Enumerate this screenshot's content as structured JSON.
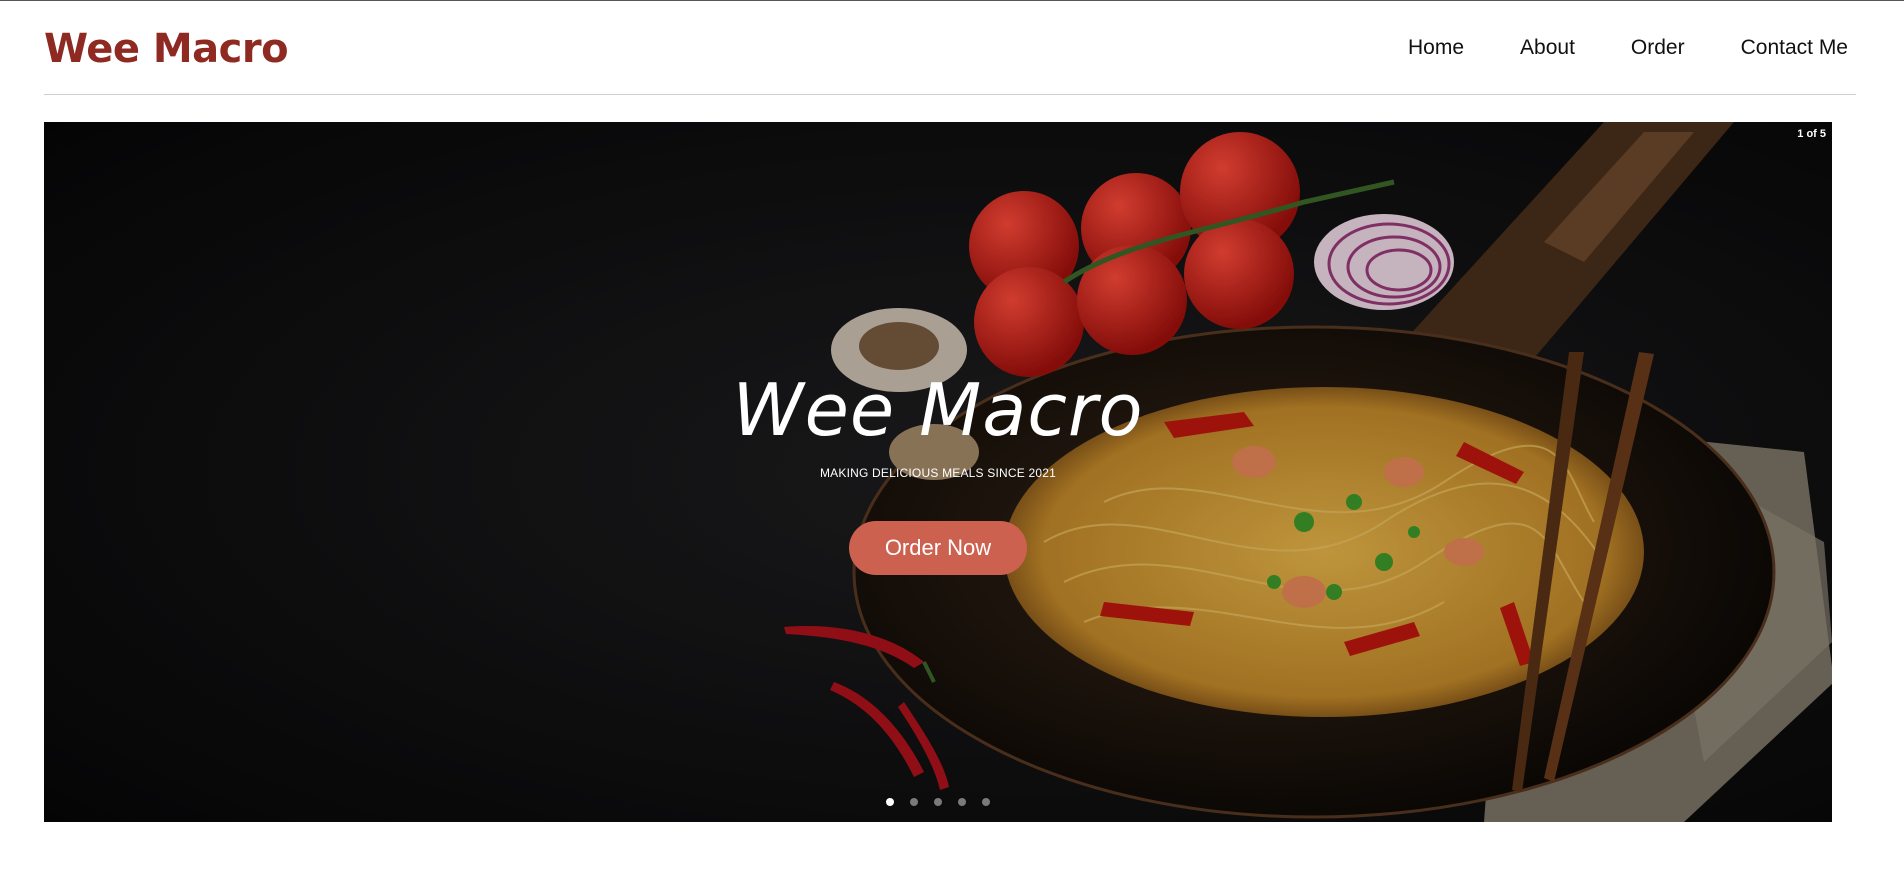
{
  "header": {
    "brand": "Wee Macro",
    "nav": [
      "Home",
      "About",
      "Order",
      "Contact Me"
    ]
  },
  "hero": {
    "slide_counter": "1 of 5",
    "title": "Wee Macro",
    "subtitle": "MAKING DELICIOUS MEALS SINCE 2021",
    "cta_label": "Order Now",
    "slide_count": 5,
    "active_slide": 1
  },
  "colors": {
    "brand": "#8e2a22",
    "cta": "#cd6150",
    "hero_background": "#0b0b0c"
  }
}
